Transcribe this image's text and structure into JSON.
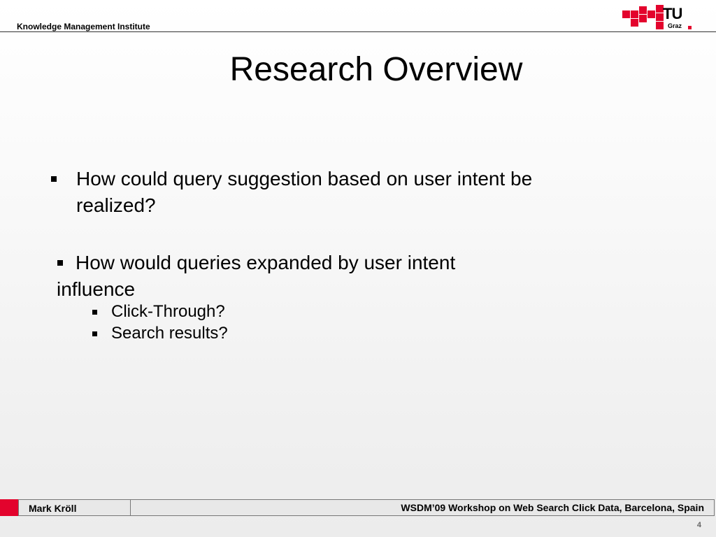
{
  "header": {
    "institute": "Knowledge Management Institute",
    "logo_text": "TU",
    "logo_subtext": "Graz"
  },
  "title": "Research Overview",
  "bullets": [
    {
      "text": "How could query suggestion based on user intent be realized?"
    },
    {
      "line1": "How would queries expanded by user intent",
      "line2": "influence",
      "sub": [
        "Click-Through?",
        "Search results?"
      ]
    }
  ],
  "footer": {
    "author": "Mark Kröll",
    "event": "WSDM’09 Workshop on Web Search Click Data, Barcelona, Spain",
    "page_number": "4"
  },
  "colors": {
    "brand_red": "#e3032d"
  }
}
